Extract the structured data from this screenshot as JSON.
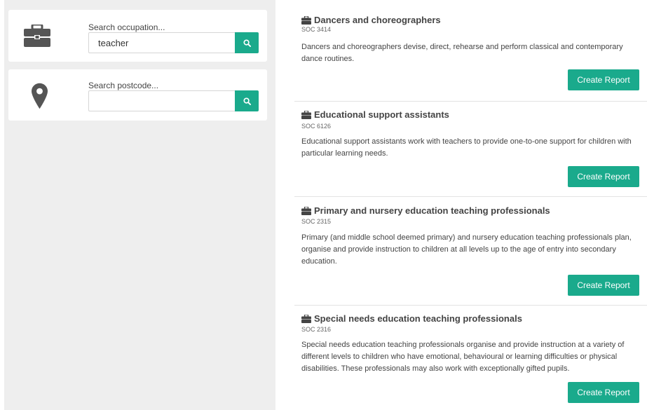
{
  "sidebar": {
    "occupation": {
      "label": "Search occupation...",
      "value": "teacher",
      "icon": "briefcase-icon"
    },
    "postcode": {
      "label": "Search postcode...",
      "value": "",
      "icon": "map-marker-icon"
    },
    "search_icon": "search-icon"
  },
  "results": [
    {
      "title": "Dancers and choreographers",
      "soc": "SOC 3414",
      "description": "Dancers and choreographers devise, direct, rehearse and perform classical and contemporary dance routines.",
      "button": "Create Report"
    },
    {
      "title": "Educational support assistants",
      "soc": "SOC 6126",
      "description": "Educational support assistants work with teachers to provide one-to-one support for children with particular learning needs.",
      "button": "Create Report"
    },
    {
      "title": "Primary and nursery education teaching professionals",
      "soc": "SOC 2315",
      "description": "Primary (and middle school deemed primary) and nursery education teaching professionals plan, organise and provide instruction to children at all levels up to the age of entry into secondary education.",
      "button": "Create Report"
    },
    {
      "title": "Special needs education teaching professionals",
      "soc": "SOC 2316",
      "description": "Special needs education teaching professionals organise and provide instruction at a variety of different levels to children who have emotional, behavioural or learning difficulties or physical disabilities. These professionals may also work with exceptionally gifted pupils.",
      "button": "Create Report"
    }
  ],
  "colors": {
    "accent": "#1aaa8c",
    "sidebar_bg": "#eeeeee",
    "icon": "#555555"
  }
}
